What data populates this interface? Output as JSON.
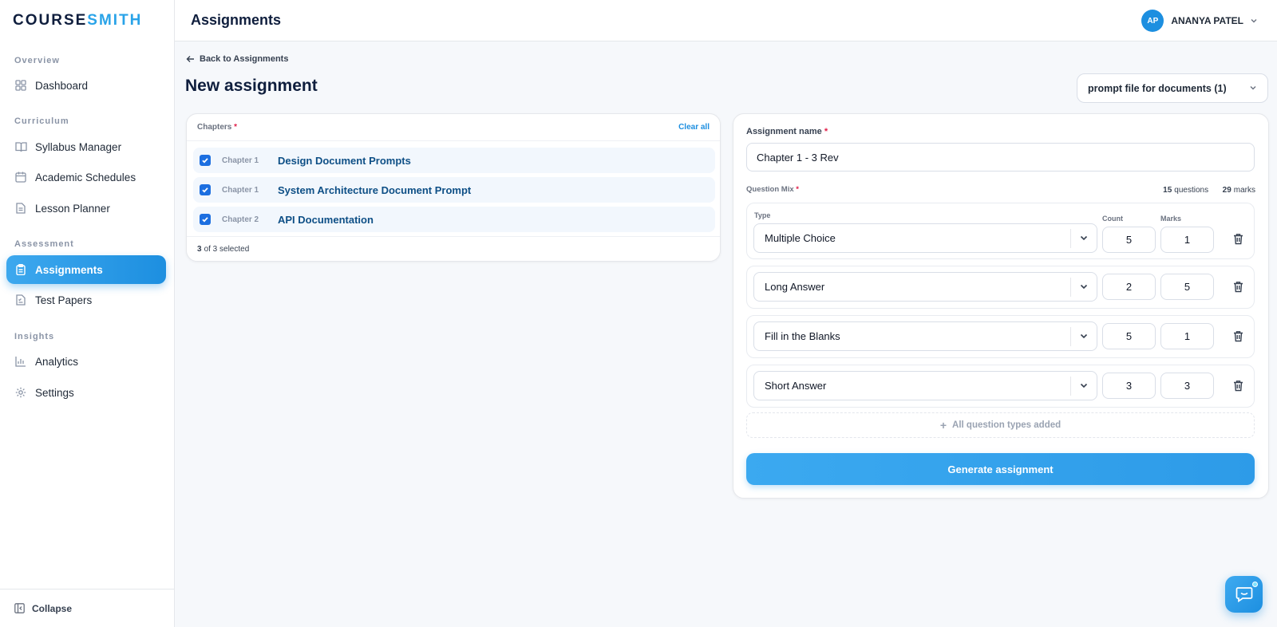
{
  "app": {
    "logo_prefix": "COURSE",
    "logo_suffix": "SMITH"
  },
  "sidebar": {
    "sections": [
      {
        "label": "Overview"
      },
      {
        "label": "Curriculum"
      },
      {
        "label": "Assessment"
      },
      {
        "label": "Insights"
      }
    ],
    "items": [
      {
        "label": "Dashboard",
        "icon": "grid-icon"
      },
      {
        "label": "Syllabus Manager",
        "icon": "book-icon"
      },
      {
        "label": "Academic Schedules",
        "icon": "calendar-icon"
      },
      {
        "label": "Lesson Planner",
        "icon": "document-icon"
      },
      {
        "label": "Assignments",
        "icon": "clipboard-icon",
        "active": true
      },
      {
        "label": "Test Papers",
        "icon": "test-paper-icon"
      },
      {
        "label": "Analytics",
        "icon": "bar-chart-icon"
      },
      {
        "label": "Settings",
        "icon": "gear-icon"
      }
    ],
    "collapse_label": "Collapse"
  },
  "header": {
    "title": "Assignments",
    "user": {
      "initials": "AP",
      "name": "ANANYA PATEL"
    }
  },
  "page": {
    "back_label": "Back to Assignments",
    "title": "New assignment",
    "template_select_value": "prompt file for documents (1)"
  },
  "chapters": {
    "label": "Chapters",
    "required_mark": "*",
    "clear_all_label": "Clear all",
    "rows": [
      {
        "chapter": "Chapter 1",
        "title": "Design Document Prompts",
        "checked": true
      },
      {
        "chapter": "Chapter 1",
        "title": "System Architecture Document Prompt",
        "checked": true
      },
      {
        "chapter": "Chapter 2",
        "title": "API Documentation",
        "checked": true
      }
    ],
    "selected_count": "3",
    "selected_suffix": "of 3 selected"
  },
  "assignment": {
    "name_label": "Assignment name",
    "required_mark": "*",
    "name_value": "Chapter 1 - 3 Rev",
    "mix_label": "Question Mix",
    "total_questions": "15",
    "total_questions_suffix": "questions",
    "total_marks": "29",
    "total_marks_suffix": "marks",
    "col_type": "Type",
    "col_count": "Count",
    "col_marks": "Marks",
    "questions": [
      {
        "type": "Multiple Choice",
        "count": "5",
        "marks": "1"
      },
      {
        "type": "Long Answer",
        "count": "2",
        "marks": "5"
      },
      {
        "type": "Fill in the Blanks",
        "count": "5",
        "marks": "1"
      },
      {
        "type": "Short Answer",
        "count": "3",
        "marks": "3"
      }
    ],
    "all_added_label": "All question types added",
    "generate_label": "Generate assignment"
  },
  "colors": {
    "accent": "#1d8fe0",
    "brand_dark": "#0f1e3d",
    "chapter_link": "#0e4f86"
  }
}
